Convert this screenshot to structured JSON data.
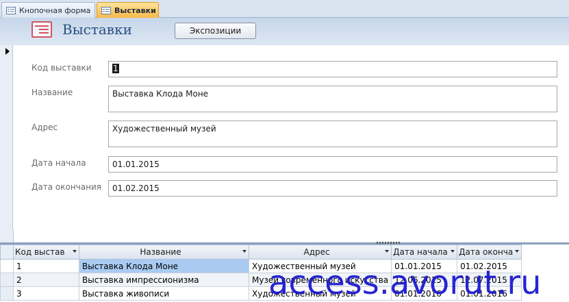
{
  "tabs": [
    {
      "label": "Кнопочная форма",
      "icon": "form-icon",
      "active": false
    },
    {
      "label": "Выставки",
      "icon": "form-icon",
      "active": true
    }
  ],
  "header": {
    "title": "Выставки",
    "icon": "form-icon",
    "button_label": "Экспозиции"
  },
  "form": {
    "fields": [
      {
        "label": "Код выставки",
        "value": "1"
      },
      {
        "label": "Название",
        "value": "Выставка Клода Моне"
      },
      {
        "label": "Адрес",
        "value": "Художественный музей"
      },
      {
        "label": "Дата начала",
        "value": "01.01.2015"
      },
      {
        "label": "Дата окончания",
        "value": "01.02.2015"
      }
    ]
  },
  "datasheet": {
    "columns": [
      "Код выстав",
      "Название",
      "Адрес",
      "Дата начала",
      "Дата оконча"
    ],
    "rows": [
      [
        "1",
        "Выставка Клода Моне",
        "Художественный музей",
        "01.01.2015",
        "01.02.2015"
      ],
      [
        "2",
        "Выставка импрессионизма",
        "Музей современного искусства",
        "12.06.2015",
        "12.07.2015"
      ],
      [
        "3",
        "Выставка живописи",
        "Художественный музей",
        "01.01.2016",
        "01.01.2016"
      ]
    ]
  },
  "watermark": "access.avorut.ru",
  "colors": {
    "active_tab": "#f7b848",
    "header_band": "#c6d6ea",
    "selected_cell": "#a9cbf2",
    "watermark": "#1c1ad0"
  }
}
